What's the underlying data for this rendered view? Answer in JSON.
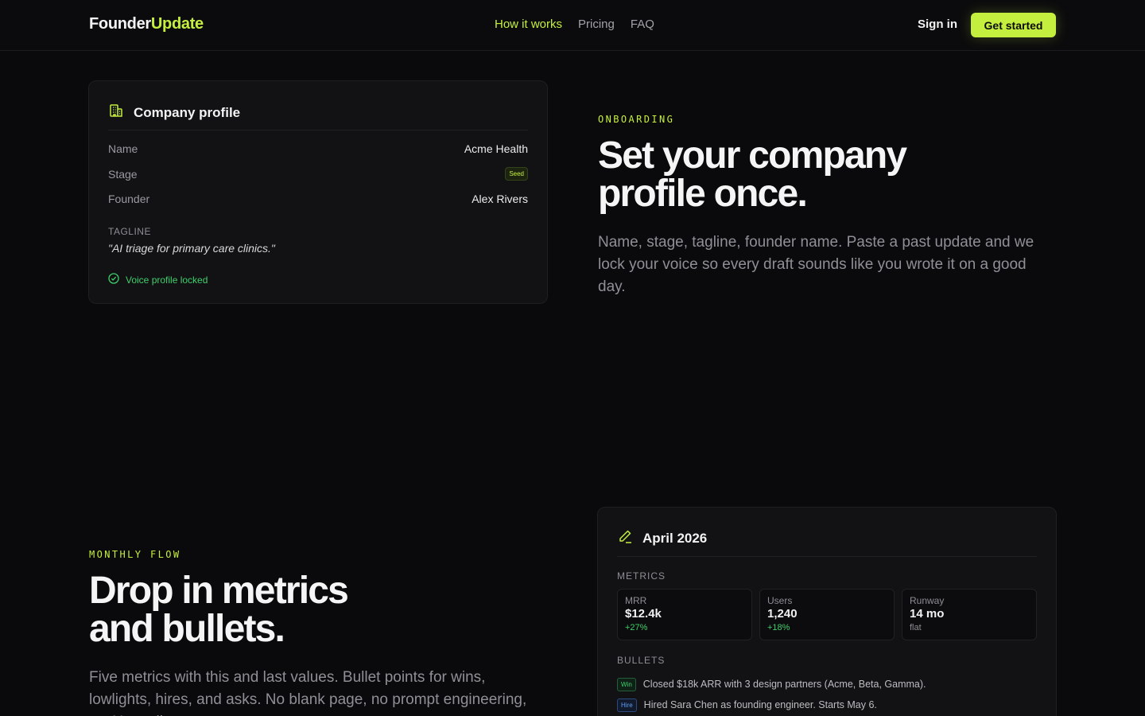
{
  "nav": {
    "logo_part1": "Founder",
    "logo_part2": "Update",
    "links": [
      "How it works",
      "Pricing",
      "FAQ"
    ],
    "signin": "Sign in",
    "cta": "Get started"
  },
  "profile_card": {
    "title": "Company profile",
    "icon": "building-icon",
    "rows": [
      {
        "label": "Name",
        "value": "Acme Health"
      },
      {
        "label": "Stage",
        "value": "Seed"
      },
      {
        "label": "Founder",
        "value": "Alex Rivers"
      }
    ],
    "tagline_label": "TAGLINE",
    "tagline": "\"AI triage for primary care clinics.\"",
    "locked_text": "Voice profile locked"
  },
  "onboarding": {
    "eyebrow": "ONBOARDING",
    "heading_line1": "Set your company",
    "heading_line2": "profile once.",
    "lead": "Name, stage, tagline, founder name. Paste a past update and we lock your voice so every draft sounds like you wrote it on a good day."
  },
  "monthly": {
    "eyebrow": "MONTHLY FLOW",
    "heading_line1": "Drop in metrics",
    "heading_line2": "and bullets.",
    "lead": "Five metrics with this and last values. Bullet points for wins, lowlights, hires, and asks. No blank page, no prompt engineering, no AI smell."
  },
  "update_card": {
    "title": "April 2026",
    "icon": "pencil-icon",
    "metrics_label": "METRICS",
    "metrics": [
      {
        "label": "MRR",
        "value": "$12.4k",
        "delta": "+27%",
        "delta_color": "#3fcf6b"
      },
      {
        "label": "Users",
        "value": "1,240",
        "delta": "+18%",
        "delta_color": "#3fcf6b"
      },
      {
        "label": "Runway",
        "value": "14 mo",
        "delta": "flat",
        "delta_color": "#8e8e94"
      }
    ],
    "bullets_label": "BULLETS",
    "bullets": [
      {
        "tag": "Win",
        "text": "Closed $18k ARR with 3 design partners (Acme, Beta, Gamma)."
      },
      {
        "tag": "Hire",
        "text": "Hired Sara Chen as founding engineer. Starts May 6."
      }
    ]
  },
  "colors": {
    "accent": "#c5ef3e",
    "positive": "#3fcf6b",
    "background": "#0a0a0c"
  }
}
